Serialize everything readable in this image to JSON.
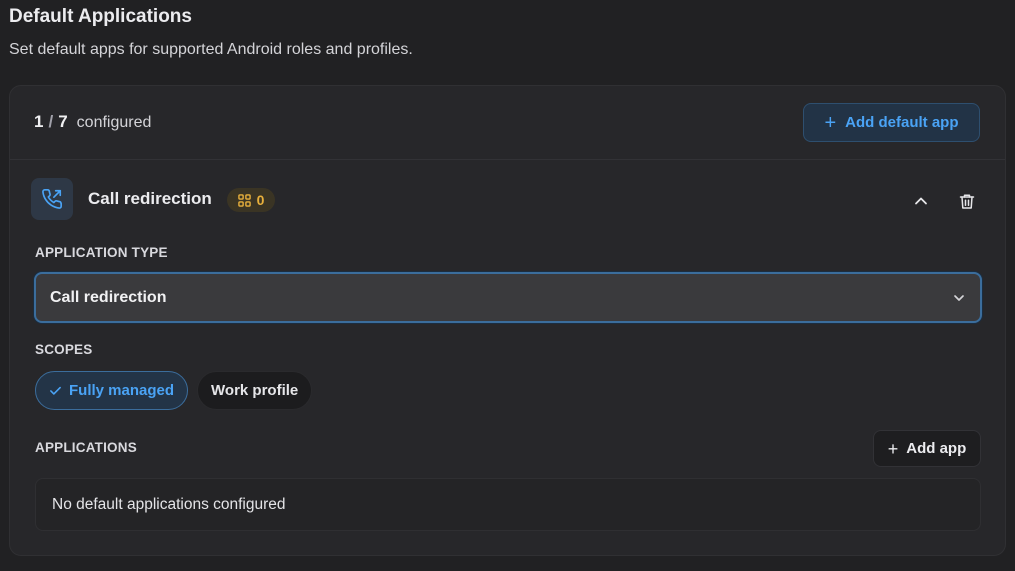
{
  "page": {
    "title": "Default Applications",
    "subtitle": "Set default apps for supported Android roles and profiles."
  },
  "summary": {
    "configured_count": "1",
    "separator": "/",
    "total_count": "7",
    "configured_label": "configured",
    "add_default_app_label": "Add default app"
  },
  "role": {
    "icon": "phone-forward-icon",
    "title": "Call redirection",
    "app_count": "0",
    "badge_icon": "grid-icon",
    "collapse_icon": "chevron-up-icon",
    "delete_icon": "trash-icon"
  },
  "application_type": {
    "label": "APPLICATION TYPE",
    "selected": "Call redirection"
  },
  "scopes": {
    "label": "SCOPES",
    "items": [
      {
        "label": "Fully managed",
        "selected": true
      },
      {
        "label": "Work profile",
        "selected": false
      }
    ]
  },
  "applications": {
    "label": "APPLICATIONS",
    "add_app_label": "Add app",
    "empty_text": "No default applications configured"
  },
  "colors": {
    "accent": "#4aa3f5",
    "badge": "#e8b03c",
    "background": "#212123",
    "card": "#27272a"
  }
}
